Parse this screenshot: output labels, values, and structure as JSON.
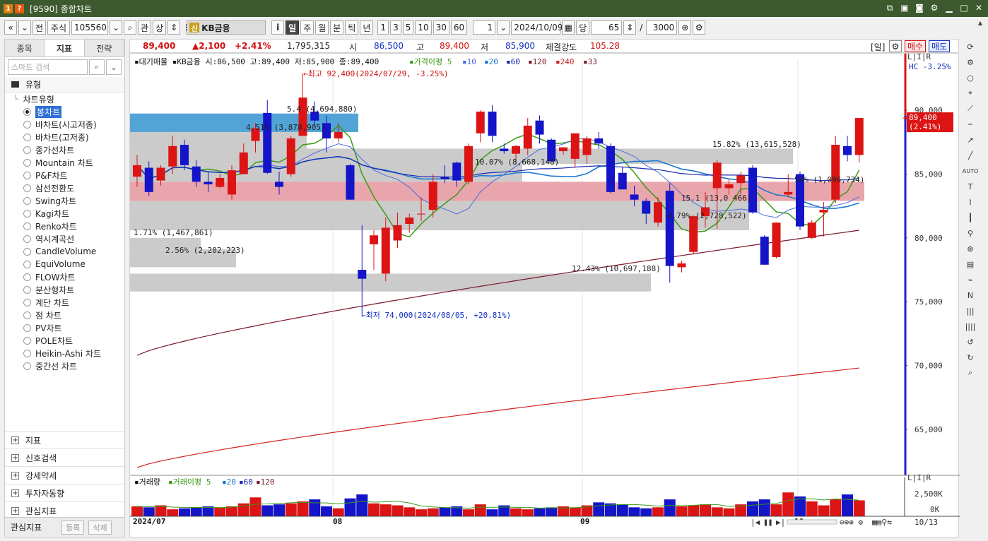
{
  "window": {
    "title": "[9590] 종합차트",
    "badge1": "1",
    "badge2": "?"
  },
  "toolbar": {
    "prev": "«",
    "down": "»",
    "jeon": "전",
    "market": "주식",
    "code": "105560",
    "gwan": "관",
    "sang": "상",
    "shin": "신",
    "stock_name": "KB금융",
    "info": "i",
    "periods": [
      "일",
      "주",
      "월",
      "분",
      "틱",
      "년"
    ],
    "active_period": "일",
    "intervals": [
      "1",
      "3",
      "5",
      "10",
      "30",
      "60"
    ],
    "count_value": "1",
    "date": "2024/10/09",
    "dang": "당",
    "bars": "65",
    "slash": "/",
    "max_bars": "3000"
  },
  "left_panel": {
    "tabs": [
      "종목",
      "지표",
      "전략"
    ],
    "active_tab": "지표",
    "search_placeholder": "스마트 검색",
    "group_label": "유형",
    "tree_head": "차트유형",
    "items": [
      "봉차트",
      "바차트(시고저종)",
      "바차트(고저종)",
      "종가선차트",
      "Mountain 차트",
      "P&F차트",
      "삼선전환도",
      "Swing차트",
      "Kagi차트",
      "Renko차트",
      "역시계곡선",
      "CandleVolume",
      "EquiVolume",
      "FLOW차트",
      "분산형차트",
      "계단 차트",
      "점 차트",
      "PV차트",
      "POLE차트",
      "Heikin-Ashi 차트",
      "중간선 차트"
    ],
    "selected_item": "봉차트",
    "footer_groups": [
      "지표",
      "신호검색",
      "강세약세",
      "투자자동향",
      "관심지표"
    ],
    "bottom_label": "관심지표",
    "bottom_buttons": [
      "등록",
      "삭제"
    ]
  },
  "infobar": {
    "price": "89,400",
    "change": "▲2,100",
    "change_pct": "+2.41%",
    "volume": "1,795,315",
    "open_label": "시",
    "open": "86,500",
    "high_label": "고",
    "high": "89,400",
    "low_label": "저",
    "low": "85,900",
    "strength_label": "체결강도",
    "strength": "105.28",
    "period_tag": "[일]",
    "buy": "매수",
    "sell": "매도"
  },
  "chart": {
    "legend": {
      "main": "대기매물",
      "ohlc": "KB금융 시:86,500 고:89,400 저:85,900 종:89,400",
      "ma_label": "가격이평",
      "ma_periods": [
        "5",
        "10",
        "20",
        "60",
        "120",
        "240",
        "33"
      ],
      "ma_colors": [
        "#3a9a18",
        "#4a6ae0",
        "#1a78d0",
        "#1828b0",
        "#7a1828",
        "#d02020",
        "#7a1828"
      ]
    },
    "hc_label": "HC -3.25%",
    "current_price_tag": "89,400",
    "current_pct_tag": "(2.41%)",
    "annotations": {
      "high": "←최고 92,400(2024/07/29, -3.25%)",
      "low": "←최저 74,000(2024/08/05, +20.81%)"
    },
    "volume_profile": [
      {
        "label": "5.4 (4,694,880)",
        "highlight": "blue"
      },
      {
        "label": "4.51% (3,878,905)",
        "highlight": "gray"
      },
      {
        "label": "15.82% (13,615,528)",
        "highlight": "gray"
      },
      {
        "label": "10.07% (8,668,148)",
        "highlight": "gray"
      },
      {
        "label": "54% (1,096,734)",
        "highlight": "red"
      },
      {
        "label": "15.1 (13,0 466)",
        "highlight": "gray"
      },
      {
        "label": "4.79% (2,728,522)",
        "highlight": "gray"
      },
      {
        "label": "1.71% (1,467,861)",
        "highlight": "gray"
      },
      {
        "label": "2.56% (2,202,223)",
        "highlight": "gray"
      },
      {
        "label": "12.43% (10,697,188)",
        "highlight": "gray"
      }
    ],
    "volume_legend": {
      "main": "거래량",
      "ma_label": "거래이평",
      "periods": [
        "5",
        "20",
        "60",
        "120"
      ]
    },
    "volume_axis": [
      "2,500K",
      "0K"
    ],
    "x_labels": [
      "2024/07",
      "08",
      "09",
      "10"
    ],
    "end_date": "10/13",
    "badge_text": "L|I|R"
  },
  "chart_data": {
    "type": "candlestick",
    "title": "",
    "y_ticks": [
      65000,
      70000,
      75000,
      80000,
      85000,
      90000
    ],
    "y_tick_labels": [
      "65,000",
      "70,000",
      "75,000",
      "80,000",
      "85,000",
      "90,000"
    ],
    "ylim": [
      61500,
      94000
    ],
    "candles": [
      {
        "o": 84800,
        "h": 86500,
        "l": 84000,
        "c": 85700
      },
      {
        "o": 85500,
        "h": 86000,
        "l": 83300,
        "c": 83600
      },
      {
        "o": 84500,
        "h": 85700,
        "l": 84100,
        "c": 85500
      },
      {
        "o": 85600,
        "h": 88000,
        "l": 85000,
        "c": 87200
      },
      {
        "o": 87300,
        "h": 87700,
        "l": 85300,
        "c": 85700
      },
      {
        "o": 85600,
        "h": 86100,
        "l": 84000,
        "c": 84400
      },
      {
        "o": 84400,
        "h": 85200,
        "l": 83600,
        "c": 84200
      },
      {
        "o": 84000,
        "h": 85000,
        "l": 83900,
        "c": 84700
      },
      {
        "o": 83400,
        "h": 85700,
        "l": 83000,
        "c": 85300
      },
      {
        "o": 85000,
        "h": 87400,
        "l": 85000,
        "c": 86700
      },
      {
        "o": 87600,
        "h": 89000,
        "l": 86700,
        "c": 88600
      },
      {
        "o": 89800,
        "h": 90800,
        "l": 85000,
        "c": 85100
      },
      {
        "o": 84400,
        "h": 85200,
        "l": 83400,
        "c": 84000
      },
      {
        "o": 85000,
        "h": 88000,
        "l": 84800,
        "c": 87800
      },
      {
        "o": 88000,
        "h": 92400,
        "l": 88000,
        "c": 91000
      },
      {
        "o": 89900,
        "h": 90700,
        "l": 88800,
        "c": 89200
      },
      {
        "o": 89000,
        "h": 89600,
        "l": 86700,
        "c": 87800
      },
      {
        "o": 87800,
        "h": 89000,
        "l": 87500,
        "c": 88300
      },
      {
        "o": 85700,
        "h": 85800,
        "l": 83000,
        "c": 83000
      },
      {
        "o": 77500,
        "h": 81000,
        "l": 74000,
        "c": 76800
      },
      {
        "o": 79500,
        "h": 80600,
        "l": 77500,
        "c": 80200
      },
      {
        "o": 77200,
        "h": 81600,
        "l": 76600,
        "c": 80800
      },
      {
        "o": 79800,
        "h": 82000,
        "l": 79200,
        "c": 81000
      },
      {
        "o": 81100,
        "h": 81900,
        "l": 80400,
        "c": 81600
      },
      {
        "o": 81900,
        "h": 83200,
        "l": 81300,
        "c": 81900
      },
      {
        "o": 82200,
        "h": 85000,
        "l": 81600,
        "c": 84400
      },
      {
        "o": 84800,
        "h": 85700,
        "l": 84300,
        "c": 84600
      },
      {
        "o": 85900,
        "h": 86000,
        "l": 84000,
        "c": 84500
      },
      {
        "o": 84400,
        "h": 87400,
        "l": 84200,
        "c": 87200
      },
      {
        "o": 88200,
        "h": 90000,
        "l": 87500,
        "c": 89900
      },
      {
        "o": 89900,
        "h": 90400,
        "l": 87500,
        "c": 88000
      },
      {
        "o": 87000,
        "h": 87400,
        "l": 86600,
        "c": 86800
      },
      {
        "o": 86600,
        "h": 87300,
        "l": 85800,
        "c": 87200
      },
      {
        "o": 87000,
        "h": 89400,
        "l": 86500,
        "c": 88800
      },
      {
        "o": 89200,
        "h": 89600,
        "l": 87400,
        "c": 88100
      },
      {
        "o": 87700,
        "h": 87800,
        "l": 86200,
        "c": 86000
      },
      {
        "o": 86800,
        "h": 87100,
        "l": 86500,
        "c": 87100
      },
      {
        "o": 86200,
        "h": 88000,
        "l": 85500,
        "c": 88200
      },
      {
        "o": 86500,
        "h": 88000,
        "l": 85800,
        "c": 87800
      },
      {
        "o": 87800,
        "h": 88300,
        "l": 87000,
        "c": 87400
      },
      {
        "o": 87200,
        "h": 87400,
        "l": 83500,
        "c": 83600
      },
      {
        "o": 85100,
        "h": 85600,
        "l": 83800,
        "c": 83800
      },
      {
        "o": 83400,
        "h": 84100,
        "l": 82500,
        "c": 83000
      },
      {
        "o": 82900,
        "h": 83100,
        "l": 81100,
        "c": 81900
      },
      {
        "o": 81200,
        "h": 83200,
        "l": 80900,
        "c": 82800
      },
      {
        "o": 83700,
        "h": 84300,
        "l": 76500,
        "c": 77800
      },
      {
        "o": 77700,
        "h": 78200,
        "l": 77300,
        "c": 78000
      },
      {
        "o": 78900,
        "h": 81800,
        "l": 78700,
        "c": 81700
      },
      {
        "o": 81700,
        "h": 83600,
        "l": 80800,
        "c": 82400
      },
      {
        "o": 83900,
        "h": 86100,
        "l": 80700,
        "c": 85900
      },
      {
        "o": 83900,
        "h": 84600,
        "l": 83400,
        "c": 84200
      },
      {
        "o": 84300,
        "h": 85200,
        "l": 83400,
        "c": 84900
      },
      {
        "o": 85500,
        "h": 85700,
        "l": 81900,
        "c": 82000
      },
      {
        "o": 80100,
        "h": 80200,
        "l": 77900,
        "c": 77900
      },
      {
        "o": 78500,
        "h": 81200,
        "l": 78400,
        "c": 81200
      },
      {
        "o": 83400,
        "h": 85000,
        "l": 83200,
        "c": 83600
      },
      {
        "o": 85000,
        "h": 85200,
        "l": 80600,
        "c": 80900
      },
      {
        "o": 80000,
        "h": 81400,
        "l": 79900,
        "c": 81200
      },
      {
        "o": 82000,
        "h": 82800,
        "l": 80100,
        "c": 82200
      },
      {
        "o": 83000,
        "h": 88000,
        "l": 82700,
        "c": 87300
      },
      {
        "o": 87200,
        "h": 88000,
        "l": 86000,
        "c": 86500
      },
      {
        "o": 86500,
        "h": 89400,
        "l": 85900,
        "c": 89400
      }
    ],
    "volume_max_k": 3200
  }
}
